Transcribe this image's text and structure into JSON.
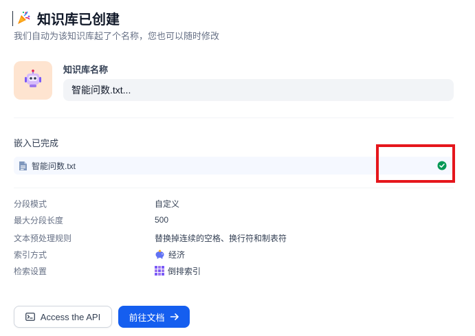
{
  "header": {
    "title": "知识库已创建",
    "subtitle": "我们自动为该知识库起了个名称，您也可以随时修改"
  },
  "dataset": {
    "name_label": "知识库名称",
    "name_value": "智能问数.txt..."
  },
  "embedding": {
    "title": "嵌入已完成",
    "files": [
      {
        "name": "智能问数.txt",
        "status": "completed"
      }
    ]
  },
  "settings": {
    "rows": [
      {
        "key": "分段模式",
        "value": "自定义"
      },
      {
        "key": "最大分段长度",
        "value": "500"
      },
      {
        "key": "文本预处理规则",
        "value": "替换掉连续的空格、换行符和制表符"
      },
      {
        "key": "索引方式",
        "value": "经济",
        "icon": "piggy-bank-icon"
      },
      {
        "key": "检索设置",
        "value": "倒排索引",
        "icon": "grid-icon"
      }
    ]
  },
  "actions": {
    "api_label": "Access the API",
    "docs_label": "前往文档"
  },
  "colors": {
    "primary": "#155eef",
    "success": "#039855",
    "highlight": "#e5161c",
    "avatar_bg": "#fee4d0"
  }
}
